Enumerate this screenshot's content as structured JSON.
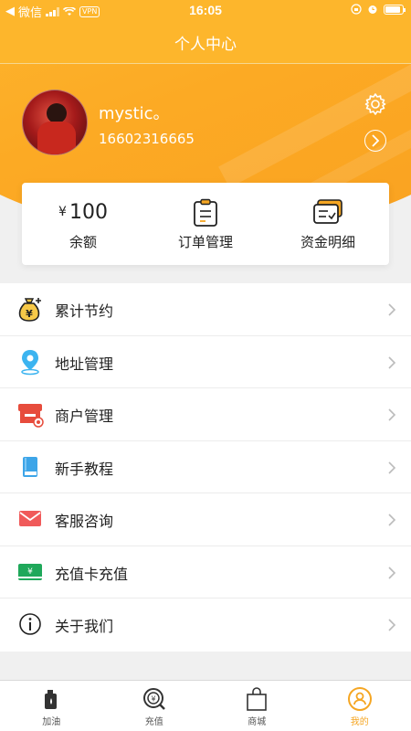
{
  "status_bar": {
    "carrier": "微信",
    "vpn": "VPN",
    "time": "16:05"
  },
  "header": {
    "title": "个人中心"
  },
  "profile": {
    "username": "mystic。",
    "phone": "16602316665"
  },
  "summary": {
    "balance_symbol": "¥",
    "balance_value": "100",
    "balance_label": "余额",
    "orders_label": "订单管理",
    "funds_label": "资金明细"
  },
  "menu": {
    "items": [
      {
        "label": "累计节约",
        "icon": "money-bag-icon"
      },
      {
        "label": "地址管理",
        "icon": "location-pin-icon"
      },
      {
        "label": "商户管理",
        "icon": "store-icon"
      },
      {
        "label": "新手教程",
        "icon": "book-icon"
      },
      {
        "label": "客服咨询",
        "icon": "mail-icon"
      },
      {
        "label": "充值卡充值",
        "icon": "recharge-card-icon"
      },
      {
        "label": "关于我们",
        "icon": "info-icon"
      }
    ]
  },
  "tabbar": {
    "tabs": [
      {
        "label": "加油",
        "icon": "fuel-icon"
      },
      {
        "label": "充值",
        "icon": "recharge-icon"
      },
      {
        "label": "商城",
        "icon": "shopping-bag-icon"
      },
      {
        "label": "我的",
        "icon": "profile-icon"
      }
    ],
    "active_index": 3
  },
  "colors": {
    "accent": "#fdb62c",
    "active_tab": "#f5a623"
  }
}
